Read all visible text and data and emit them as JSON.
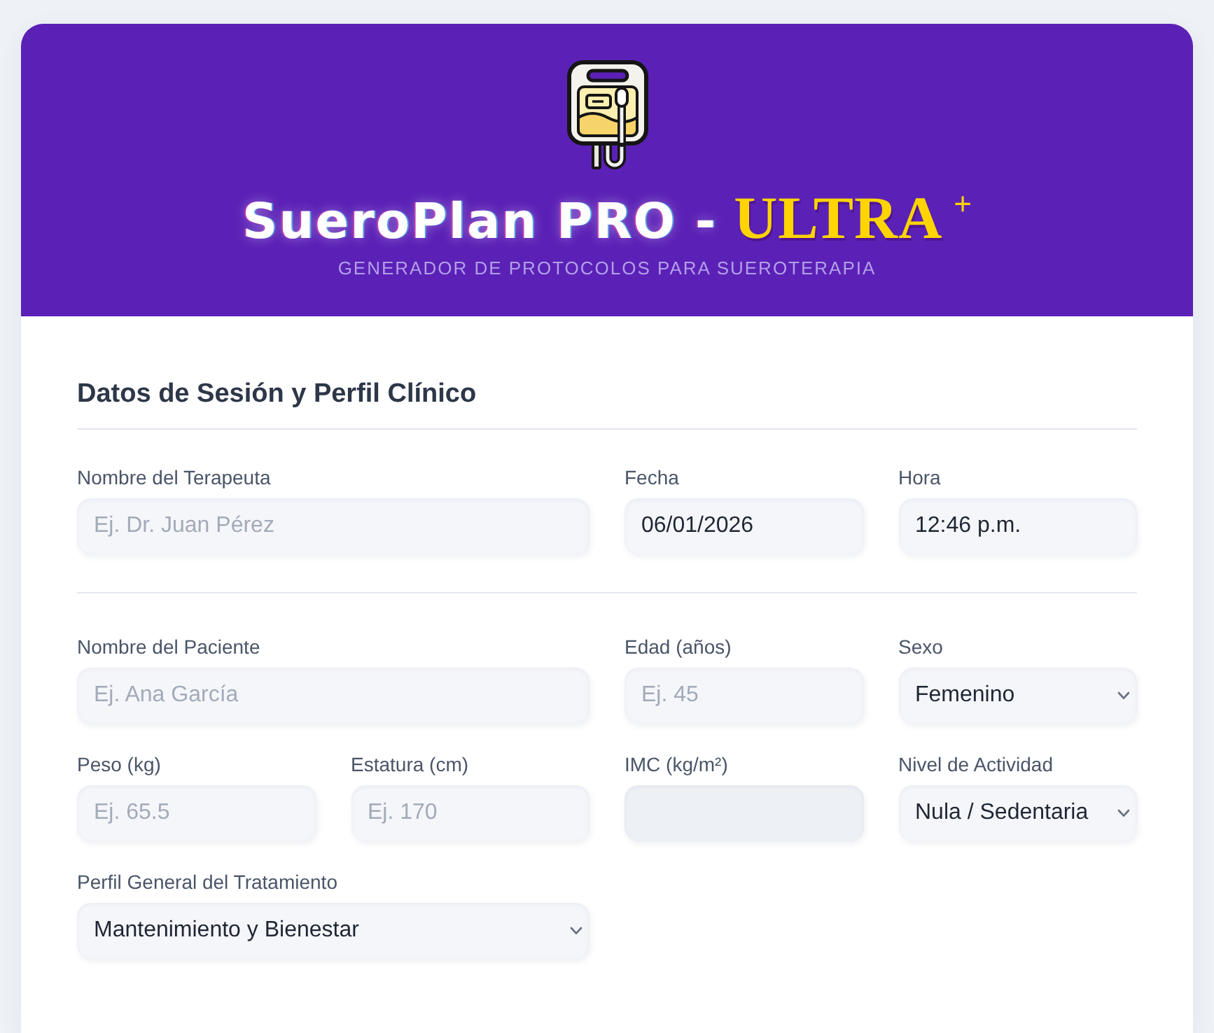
{
  "header": {
    "title": "SueroPlan PRO -",
    "highlight": "ULTRA",
    "mark": "+",
    "subtitle": "GENERADOR DE PROTOCOLOS PARA SUEROTERAPIA"
  },
  "form": {
    "title": "Datos de Sesión y Perfil Clínico",
    "groups": [
      {
        "rows": [
          {
            "fields": [
              {
                "kind": "input",
                "label": "Nombre del Terapeuta",
                "placeholder": "Ej. Dr. Juan Pérez"
              },
              {
                "kind": "input",
                "label": "Fecha",
                "value": "06/01/2026"
              },
              {
                "kind": "input",
                "label": "Hora",
                "value": "12:46 p.m."
              }
            ]
          }
        ]
      },
      {
        "rows": [
          {
            "fields": [
              {
                "kind": "input",
                "label": "Nombre del Paciente",
                "placeholder": "Ej. Ana García"
              },
              {
                "kind": "input",
                "label": "Edad (años)",
                "placeholder": "Ej. 45"
              },
              {
                "kind": "select",
                "label": "Sexo",
                "value": "Femenino"
              }
            ]
          },
          {
            "fields": [
              {
                "kind": "input",
                "label": "Peso (kg)",
                "placeholder": "Ej. 65.5"
              },
              {
                "kind": "input",
                "label": "Estatura (cm)",
                "placeholder": "Ej. 170"
              },
              {
                "kind": "computed",
                "label": "IMC (kg/m²)"
              },
              {
                "kind": "select",
                "label": "Nivel de Actividad",
                "value": "Nula / Sedentaria"
              }
            ]
          },
          {
            "fields": [
              {
                "kind": "select",
                "label": "Perfil General del Tratamiento",
                "value": "Mantenimiento y Bienestar"
              }
            ]
          }
        ]
      }
    ]
  }
}
